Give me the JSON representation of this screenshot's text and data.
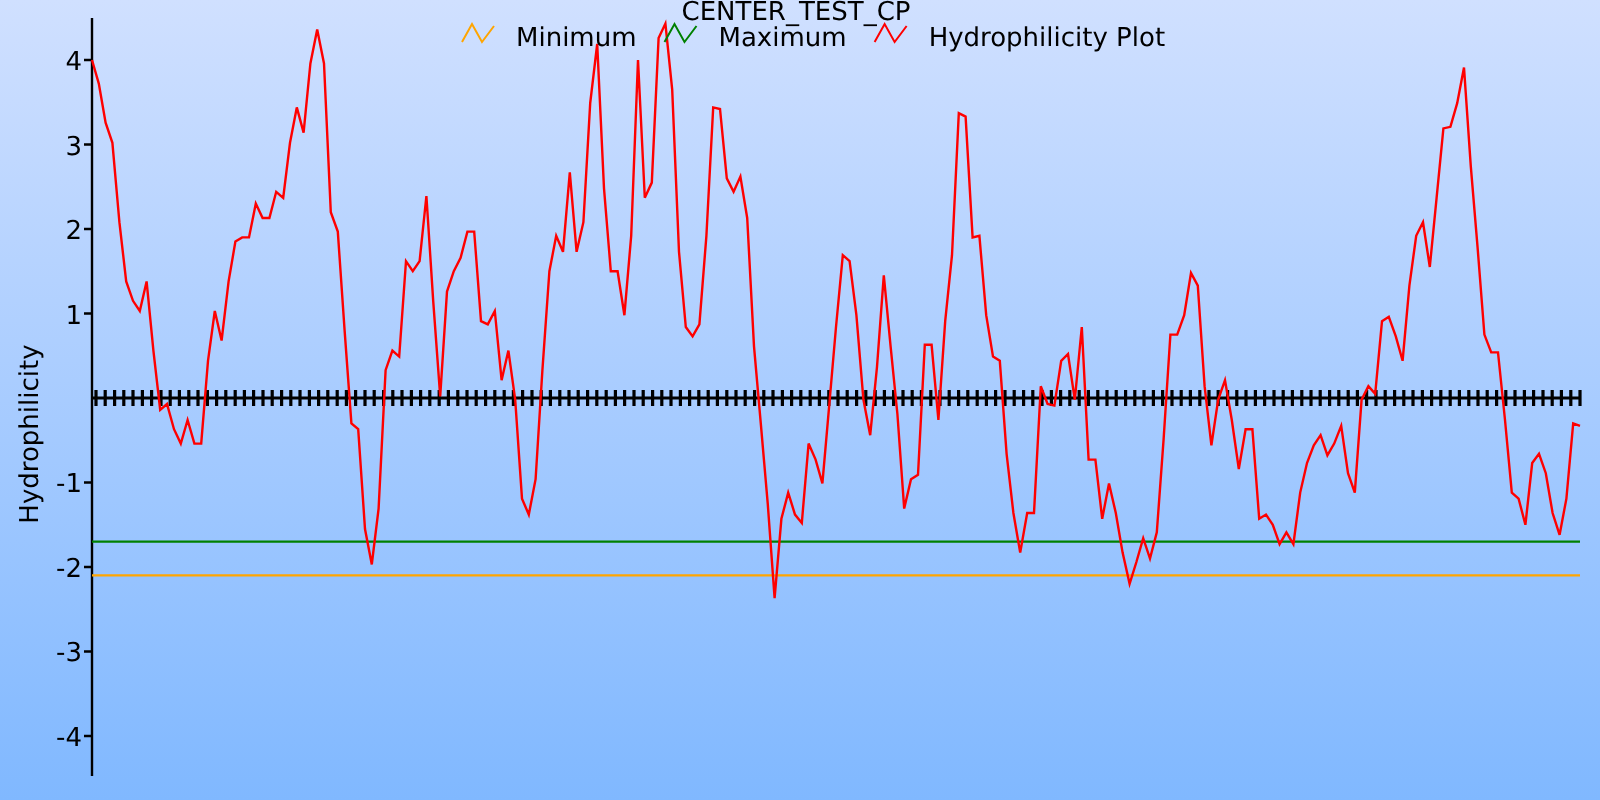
{
  "chart": {
    "chart_data": {
      "type": "line",
      "title": "CENTER_TEST_CP",
      "ylabel": "Hydrophilicity",
      "categories": [
        null,
        null,
        null,
        null,
        null,
        null,
        null,
        null,
        null,
        null,
        null,
        null,
        null,
        null,
        null,
        null,
        null,
        null,
        null,
        null,
        null,
        null,
        null,
        null,
        null,
        null,
        null,
        null,
        null,
        null,
        null,
        null,
        null,
        null,
        null,
        null,
        null,
        null,
        null,
        null,
        null,
        null,
        null,
        null,
        null,
        null,
        null,
        null,
        null,
        null,
        null,
        null,
        null,
        null,
        null,
        null,
        null,
        null,
        null,
        null,
        null,
        null,
        null,
        null,
        null,
        null,
        null,
        null,
        null,
        null,
        null,
        null,
        null,
        null,
        null,
        null,
        null,
        null,
        null,
        null,
        null,
        null,
        null,
        null,
        null,
        null,
        null,
        null,
        null,
        null,
        null,
        null,
        null,
        null,
        null,
        null,
        null,
        null,
        null,
        null,
        null,
        null,
        null,
        null,
        null,
        null,
        null,
        null,
        null,
        null,
        null,
        null,
        null,
        null,
        null,
        null,
        null,
        null,
        null,
        null,
        null,
        null,
        null,
        null,
        null,
        null,
        null,
        null,
        null,
        null,
        null,
        null,
        null,
        null,
        null,
        null,
        null,
        null,
        null,
        null,
        null,
        null,
        null,
        null,
        null,
        null,
        null,
        null,
        null,
        null,
        null,
        null,
        null,
        null,
        null,
        null,
        null,
        null,
        null,
        null,
        null,
        null,
        null,
        null,
        null,
        null,
        null,
        null,
        null,
        null,
        null,
        null,
        null,
        null,
        null,
        null,
        null,
        null,
        null,
        null,
        null,
        null,
        null,
        null,
        null,
        null,
        null,
        null,
        null,
        null,
        null,
        null,
        null,
        null,
        null,
        null,
        null,
        null,
        null,
        null,
        null,
        null,
        null,
        null,
        null,
        null,
        null,
        null,
        null,
        null,
        null,
        null,
        null,
        null,
        null,
        null,
        null,
        null,
        null
      ],
      "legend": "top",
      "ylim": [
        -4.45,
        4.45
      ],
      "yticks": [
        {
          "value": -4,
          "label": "-4"
        },
        {
          "value": -3,
          "label": "-3"
        },
        {
          "value": -2,
          "label": "-2"
        },
        {
          "value": -1,
          "label": "-1"
        },
        {
          "value": 1,
          "label": "1"
        },
        {
          "value": 2,
          "label": "2"
        },
        {
          "value": 3,
          "label": "3"
        },
        {
          "value": 4,
          "label": "4"
        }
      ],
      "series": [
        {
          "name": "Minimum",
          "color": "#ffa500",
          "values": [
            -2.1,
            -2.1,
            -2.1,
            -2.1,
            -2.1,
            -2.1,
            -2.1,
            -2.1,
            -2.1,
            -2.1,
            -2.1,
            -2.1,
            -2.1,
            -2.1,
            -2.1,
            -2.1,
            -2.1,
            -2.1,
            -2.1,
            -2.1,
            -2.1,
            -2.1,
            -2.1,
            -2.1,
            -2.1,
            -2.1,
            -2.1,
            -2.1,
            -2.1,
            -2.1,
            -2.1,
            -2.1,
            -2.1,
            -2.1,
            -2.1,
            -2.1,
            -2.1,
            -2.1,
            -2.1,
            -2.1,
            -2.1,
            -2.1,
            -2.1,
            -2.1,
            -2.1,
            -2.1,
            -2.1,
            -2.1,
            -2.1,
            -2.1,
            -2.1,
            -2.1,
            -2.1,
            -2.1,
            -2.1,
            -2.1,
            -2.1,
            -2.1,
            -2.1,
            -2.1,
            -2.1,
            -2.1,
            -2.1,
            -2.1,
            -2.1,
            -2.1,
            -2.1,
            -2.1,
            -2.1,
            -2.1,
            -2.1,
            -2.1,
            -2.1,
            -2.1,
            -2.1,
            -2.1,
            -2.1,
            -2.1,
            -2.1,
            -2.1,
            -2.1,
            -2.1,
            -2.1,
            -2.1,
            -2.1,
            -2.1,
            -2.1,
            -2.1,
            -2.1,
            -2.1,
            -2.1,
            -2.1,
            -2.1,
            -2.1,
            -2.1,
            -2.1,
            -2.1,
            -2.1,
            -2.1,
            -2.1,
            -2.1,
            -2.1,
            -2.1,
            -2.1,
            -2.1,
            -2.1,
            -2.1,
            -2.1,
            -2.1,
            -2.1,
            -2.1,
            -2.1,
            -2.1,
            -2.1,
            -2.1,
            -2.1,
            -2.1,
            -2.1,
            -2.1,
            -2.1,
            -2.1,
            -2.1,
            -2.1,
            -2.1,
            -2.1,
            -2.1,
            -2.1,
            -2.1,
            -2.1,
            -2.1,
            -2.1,
            -2.1,
            -2.1,
            -2.1,
            -2.1,
            -2.1,
            -2.1,
            -2.1,
            -2.1,
            -2.1,
            -2.1,
            -2.1,
            -2.1,
            -2.1,
            -2.1,
            -2.1,
            -2.1,
            -2.1,
            -2.1,
            -2.1,
            -2.1,
            -2.1,
            -2.1,
            -2.1,
            -2.1,
            -2.1,
            -2.1,
            -2.1,
            -2.1,
            -2.1,
            -2.1,
            -2.1,
            -2.1,
            -2.1,
            -2.1,
            -2.1,
            -2.1,
            -2.1,
            -2.1,
            -2.1,
            -2.1,
            -2.1,
            -2.1,
            -2.1,
            -2.1,
            -2.1,
            -2.1,
            -2.1,
            -2.1,
            -2.1,
            -2.1,
            -2.1,
            -2.1,
            -2.1,
            -2.1,
            -2.1,
            -2.1,
            -2.1,
            -2.1,
            -2.1,
            -2.1,
            -2.1,
            -2.1,
            -2.1,
            -2.1,
            -2.1,
            -2.1,
            -2.1,
            -2.1,
            -2.1,
            -2.1,
            -2.1,
            -2.1,
            -2.1,
            -2.1,
            -2.1,
            -2.1,
            -2.1,
            -2.1,
            -2.1,
            -2.1,
            -2.1,
            -2.1,
            -2.1,
            -2.1,
            -2.1,
            -2.1,
            -2.1,
            -2.1
          ]
        },
        {
          "name": "Maximum",
          "color": "#008000",
          "values": [
            -1.7,
            -1.7,
            -1.7,
            -1.7,
            -1.7,
            -1.7,
            -1.7,
            -1.7,
            -1.7,
            -1.7,
            -1.7,
            -1.7,
            -1.7,
            -1.7,
            -1.7,
            -1.7,
            -1.7,
            -1.7,
            -1.7,
            -1.7,
            -1.7,
            -1.7,
            -1.7,
            -1.7,
            -1.7,
            -1.7,
            -1.7,
            -1.7,
            -1.7,
            -1.7,
            -1.7,
            -1.7,
            -1.7,
            -1.7,
            -1.7,
            -1.7,
            -1.7,
            -1.7,
            -1.7,
            -1.7,
            -1.7,
            -1.7,
            -1.7,
            -1.7,
            -1.7,
            -1.7,
            -1.7,
            -1.7,
            -1.7,
            -1.7,
            -1.7,
            -1.7,
            -1.7,
            -1.7,
            -1.7,
            -1.7,
            -1.7,
            -1.7,
            -1.7,
            -1.7,
            -1.7,
            -1.7,
            -1.7,
            -1.7,
            -1.7,
            -1.7,
            -1.7,
            -1.7,
            -1.7,
            -1.7,
            -1.7,
            -1.7,
            -1.7,
            -1.7,
            -1.7,
            -1.7,
            -1.7,
            -1.7,
            -1.7,
            -1.7,
            -1.7,
            -1.7,
            -1.7,
            -1.7,
            -1.7,
            -1.7,
            -1.7,
            -1.7,
            -1.7,
            -1.7,
            -1.7,
            -1.7,
            -1.7,
            -1.7,
            -1.7,
            -1.7,
            -1.7,
            -1.7,
            -1.7,
            -1.7,
            -1.7,
            -1.7,
            -1.7,
            -1.7,
            -1.7,
            -1.7,
            -1.7,
            -1.7,
            -1.7,
            -1.7,
            -1.7,
            -1.7,
            -1.7,
            -1.7,
            -1.7,
            -1.7,
            -1.7,
            -1.7,
            -1.7,
            -1.7,
            -1.7,
            -1.7,
            -1.7,
            -1.7,
            -1.7,
            -1.7,
            -1.7,
            -1.7,
            -1.7,
            -1.7,
            -1.7,
            -1.7,
            -1.7,
            -1.7,
            -1.7,
            -1.7,
            -1.7,
            -1.7,
            -1.7,
            -1.7,
            -1.7,
            -1.7,
            -1.7,
            -1.7,
            -1.7,
            -1.7,
            -1.7,
            -1.7,
            -1.7,
            -1.7,
            -1.7,
            -1.7,
            -1.7,
            -1.7,
            -1.7,
            -1.7,
            -1.7,
            -1.7,
            -1.7,
            -1.7,
            -1.7,
            -1.7,
            -1.7,
            -1.7,
            -1.7,
            -1.7,
            -1.7,
            -1.7,
            -1.7,
            -1.7,
            -1.7,
            -1.7,
            -1.7,
            -1.7,
            -1.7,
            -1.7,
            -1.7,
            -1.7,
            -1.7,
            -1.7,
            -1.7,
            -1.7,
            -1.7,
            -1.7,
            -1.7,
            -1.7,
            -1.7,
            -1.7,
            -1.7,
            -1.7,
            -1.7,
            -1.7,
            -1.7,
            -1.7,
            -1.7,
            -1.7,
            -1.7,
            -1.7,
            -1.7,
            -1.7,
            -1.7,
            -1.7,
            -1.7,
            -1.7,
            -1.7,
            -1.7,
            -1.7,
            -1.7,
            -1.7,
            -1.7,
            -1.7,
            -1.7,
            -1.7,
            -1.7,
            -1.7,
            -1.7,
            -1.7,
            -1.7,
            -1.7
          ]
        },
        {
          "name": "Hydrophilicity Plot",
          "color": "#ff0000",
          "values": [
            4.0,
            3.72,
            3.26,
            3.02,
            2.08,
            1.38,
            1.15,
            1.03,
            1.38,
            0.56,
            -0.14,
            -0.07,
            -0.37,
            -0.54,
            -0.26,
            -0.54,
            -0.54,
            0.44,
            1.03,
            0.68,
            1.38,
            1.85,
            1.9,
            1.9,
            2.3,
            2.13,
            2.13,
            2.44,
            2.37,
            3.02,
            3.44,
            3.14,
            3.96,
            4.36,
            3.96,
            2.2,
            1.97,
            0.8,
            -0.3,
            -0.37,
            -1.55,
            -1.97,
            -1.31,
            0.33,
            0.56,
            0.49,
            1.62,
            1.5,
            1.62,
            2.39,
            1.15,
            0.02,
            1.26,
            1.5,
            1.66,
            1.97,
            1.97,
            0.91,
            0.87,
            1.03,
            0.21,
            0.56,
            -0.02,
            -1.19,
            -1.38,
            -0.96,
            0.33,
            1.5,
            1.92,
            1.73,
            2.67,
            1.73,
            2.08,
            3.49,
            4.19,
            2.48,
            1.5,
            1.5,
            0.98,
            1.92,
            4.0,
            2.37,
            2.55,
            4.26,
            4.43,
            3.65,
            1.73,
            0.84,
            0.73,
            0.87,
            1.92,
            3.44,
            3.42,
            2.6,
            2.44,
            2.62,
            2.13,
            0.61,
            -0.33,
            -1.26,
            -2.37,
            -1.43,
            -1.12,
            -1.38,
            -1.48,
            -0.54,
            -0.73,
            -1.01,
            -0.09,
            0.84,
            1.69,
            1.62,
            0.98,
            -0.02,
            -0.44,
            0.37,
            1.45,
            0.61,
            -0.19,
            -1.31,
            -0.96,
            -0.91,
            0.63,
            0.63,
            -0.26,
            0.91,
            1.69,
            3.37,
            3.33,
            1.9,
            1.92,
            0.98,
            0.49,
            0.44,
            -0.66,
            -1.36,
            -1.83,
            -1.36,
            -1.36,
            0.14,
            -0.07,
            -0.09,
            0.44,
            0.52,
            -0.02,
            0.84,
            -0.73,
            -0.73,
            -1.43,
            -1.01,
            -1.36,
            -1.83,
            -2.2,
            -1.94,
            -1.66,
            -1.9,
            -1.59,
            -0.49,
            0.75,
            0.75,
            0.98,
            1.48,
            1.33,
            0.14,
            -0.56,
            -0.02,
            0.21,
            -0.26,
            -0.84,
            -0.37,
            -0.37,
            -1.43,
            -1.38,
            -1.5,
            -1.73,
            -1.59,
            -1.73,
            -1.12,
            -0.77,
            -0.56,
            -0.44,
            -0.68,
            -0.54,
            -0.33,
            -0.89,
            -1.12,
            -0.02,
            0.14,
            0.05,
            0.91,
            0.96,
            0.73,
            0.44,
            1.33,
            1.92,
            2.08,
            1.55,
            2.37,
            3.19,
            3.21,
            3.49,
            3.91,
            2.74,
            1.78,
            0.75,
            0.54,
            0.54,
            -0.26,
            -1.12,
            -1.19,
            -1.5,
            -0.77,
            -0.66,
            -0.89,
            -1.36,
            -1.62,
            -1.19,
            -0.3,
            -0.33
          ]
        }
      ]
    }
  }
}
